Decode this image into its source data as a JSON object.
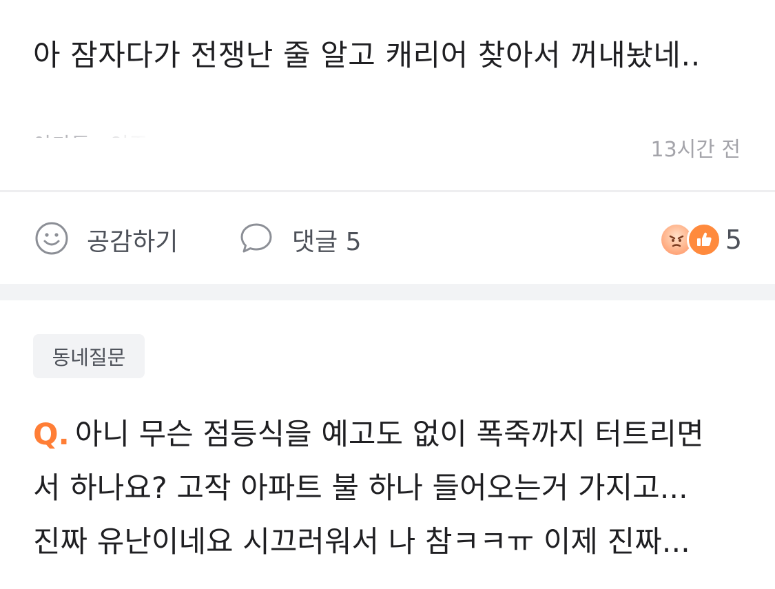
{
  "post1": {
    "text": "아 잠자다가 전쟁난 줄 알고 캐리어 찾아서 꺼내놨네..",
    "location": "아가동 · 인증",
    "time": "13시간 전"
  },
  "actions": {
    "like_label": "공감하기",
    "comment_label": "댓글 5",
    "reaction_count": "5",
    "icons": [
      "smile-icon",
      "speech-bubble-icon",
      "angry-face-icon",
      "thumbs-up-icon"
    ],
    "colors": {
      "accent": "#ff7e36",
      "like_reaction": "#ff8a3d"
    }
  },
  "post2": {
    "category": "동네질문",
    "q_prefix": "Q.",
    "lines": [
      "아니 무슨 점등식을 예고도 없이 폭죽까지 터트리면",
      "서 하나요? 고작 아파트 불 하나 들어오는거 가지고...",
      "진짜 유난이네요 시끄러워서 나 참ㅋㅋㅠ 이제 진짜..."
    ]
  }
}
